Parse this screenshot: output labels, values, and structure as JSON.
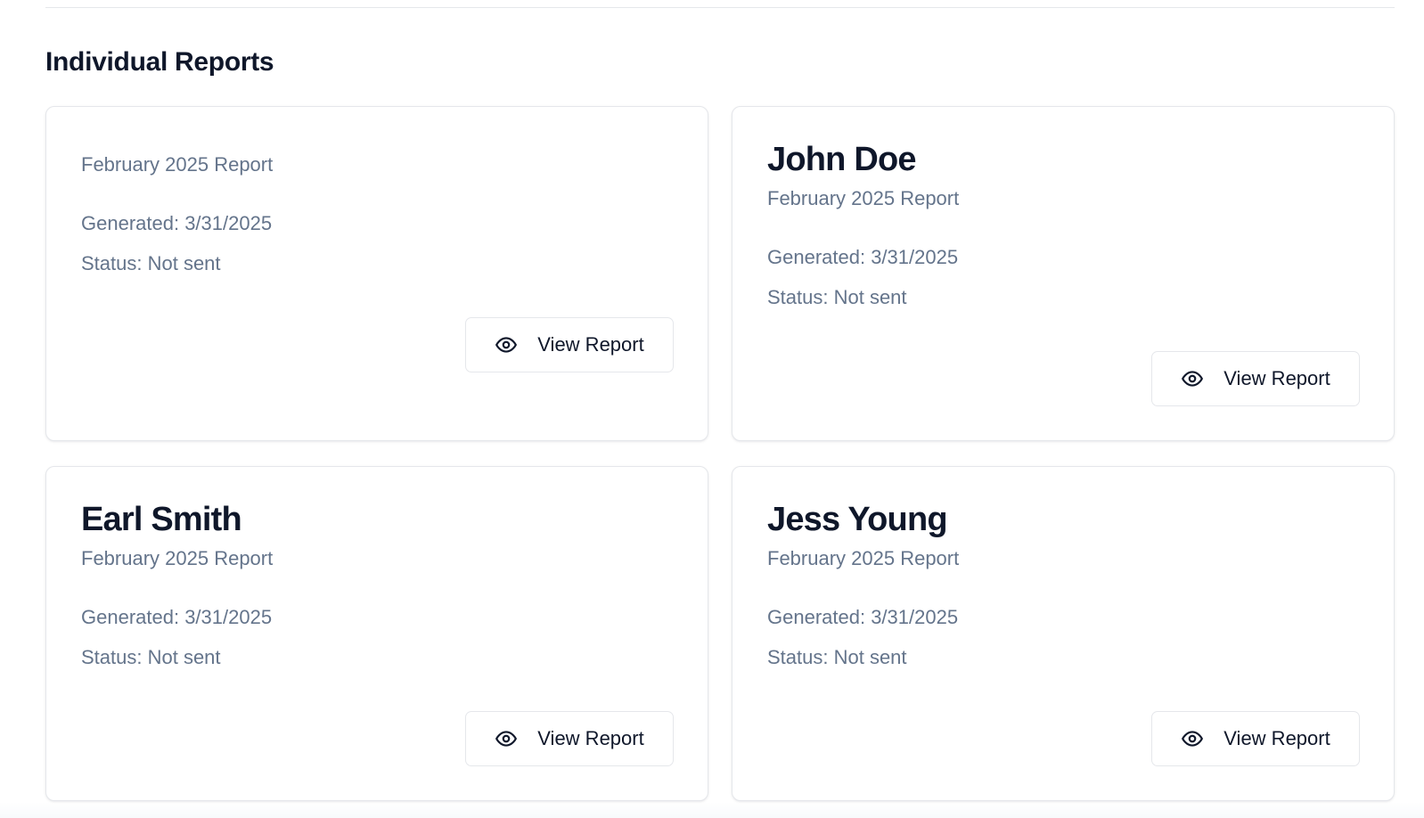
{
  "section": {
    "title": "Individual Reports"
  },
  "reports": [
    {
      "name": "",
      "period": "February 2025 Report",
      "generated": "Generated: 3/31/2025",
      "status": "Status: Not sent",
      "button_label": "View Report"
    },
    {
      "name": "John Doe",
      "period": "February 2025 Report",
      "generated": "Generated: 3/31/2025",
      "status": "Status: Not sent",
      "button_label": "View Report"
    },
    {
      "name": "Earl Smith",
      "period": "February 2025 Report",
      "generated": "Generated: 3/31/2025",
      "status": "Status: Not sent",
      "button_label": "View Report"
    },
    {
      "name": "Jess Young",
      "period": "February 2025 Report",
      "generated": "Generated: 3/31/2025",
      "status": "Status: Not sent",
      "button_label": "View Report"
    }
  ],
  "icons": {
    "view_button": "eye-icon"
  },
  "colors": {
    "heading": "#0f172a",
    "muted_text": "#64748b",
    "border": "#e5e7eb",
    "background": "#ffffff"
  }
}
